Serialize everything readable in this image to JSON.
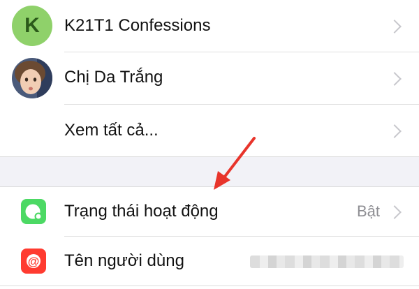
{
  "contacts": [
    {
      "label": "K21T1 Confessions",
      "avatar_letter": "K"
    },
    {
      "label": "Chị Da Trắng"
    },
    {
      "label": "Xem tất cả..."
    }
  ],
  "settings": [
    {
      "label": "Trạng thái hoạt động",
      "value": "Bật",
      "icon": "active-status-icon",
      "icon_color": "#4cd964"
    },
    {
      "label": "Tên người dùng",
      "icon": "at-sign-icon",
      "icon_color": "#ff3b30",
      "at_symbol": "@"
    }
  ],
  "colors": {
    "section_gap": "#f2f2f7",
    "arrow": "#e8342b",
    "chevron": "#c7c7cc",
    "value_text": "#8e8e93"
  }
}
